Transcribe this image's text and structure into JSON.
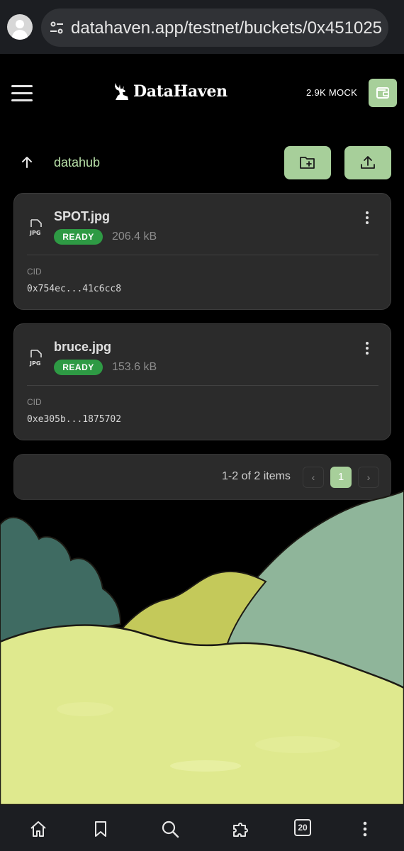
{
  "browser": {
    "url": "datahaven.app/testnet/buckets/0x451025"
  },
  "app": {
    "brand": "DataHaven",
    "balance": "2.9K MOCK"
  },
  "toolbar": {
    "folder_name": "datahub"
  },
  "files": [
    {
      "name": "SPOT.jpg",
      "status": "READY",
      "size": "206.4 kB",
      "cid_label": "CID",
      "cid": "0x754ec...41c6cc8"
    },
    {
      "name": "bruce.jpg",
      "status": "READY",
      "size": "153.6 kB",
      "cid_label": "CID",
      "cid": "0xe305b...1875702"
    }
  ],
  "pagination": {
    "summary": "1-2 of 2 items",
    "prev": "‹",
    "current_page": "1",
    "next": "›"
  },
  "bottom_nav": {
    "tabs_count": "20"
  },
  "colors": {
    "accent": "#a7cf9a",
    "status_ready": "#2e9a44",
    "card_bg": "#2b2b2b"
  },
  "icons": [
    "tune-icon",
    "hamburger-menu-icon",
    "wallet-icon",
    "arrow-up-icon",
    "new-folder-icon",
    "upload-icon",
    "jpg-file-icon",
    "more-vert-icon",
    "home-icon",
    "bookmark-icon",
    "search-icon",
    "extensions-icon",
    "tabs-icon"
  ]
}
